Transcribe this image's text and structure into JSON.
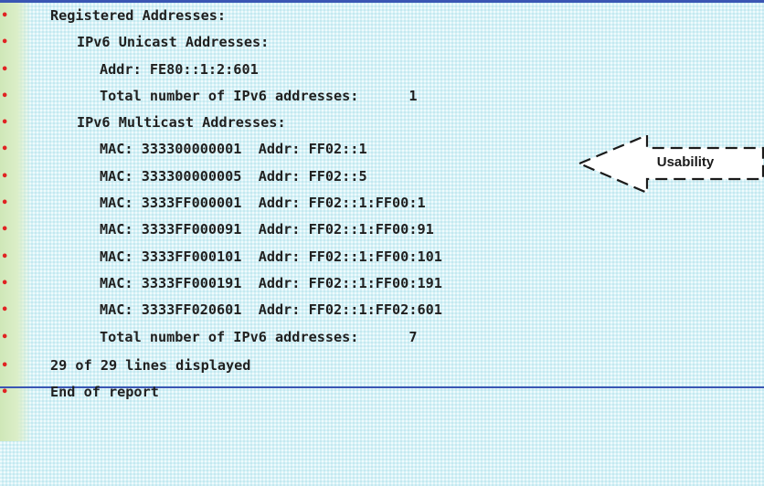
{
  "report": {
    "lines": [
      {
        "text": "Registered Addresses:"
      },
      {
        "text": "IPv6 Unicast Addresses:"
      },
      {
        "text": "Addr: FE80::1:2:601"
      },
      {
        "text": "Total number of IPv6 addresses:      1"
      },
      {
        "text": "IPv6 Multicast Addresses:"
      },
      {
        "text": "MAC: 333300000001  Addr: FF02::1"
      },
      {
        "text": "MAC: 333300000005  Addr: FF02::5"
      },
      {
        "text": "MAC: 3333FF000001  Addr: FF02::1:FF00:1"
      },
      {
        "text": "MAC: 3333FF000091  Addr: FF02::1:FF00:91"
      },
      {
        "text": "MAC: 3333FF000101  Addr: FF02::1:FF00:101"
      },
      {
        "text": "MAC: 3333FF000191  Addr: FF02::1:FF00:191"
      },
      {
        "text": "MAC: 3333FF020601  Addr: FF02::1:FF02:601"
      },
      {
        "text": "Total number of IPv6 addresses:      7"
      },
      {
        "text": "29 of 29 lines displayed"
      },
      {
        "text": "End of report"
      }
    ],
    "bullet": "•"
  },
  "callout": {
    "label": "Usability"
  },
  "colors": {
    "background": "#d6f2f7",
    "bullet": "#e02323",
    "rule": "#3a56b4",
    "text": "#202020"
  }
}
